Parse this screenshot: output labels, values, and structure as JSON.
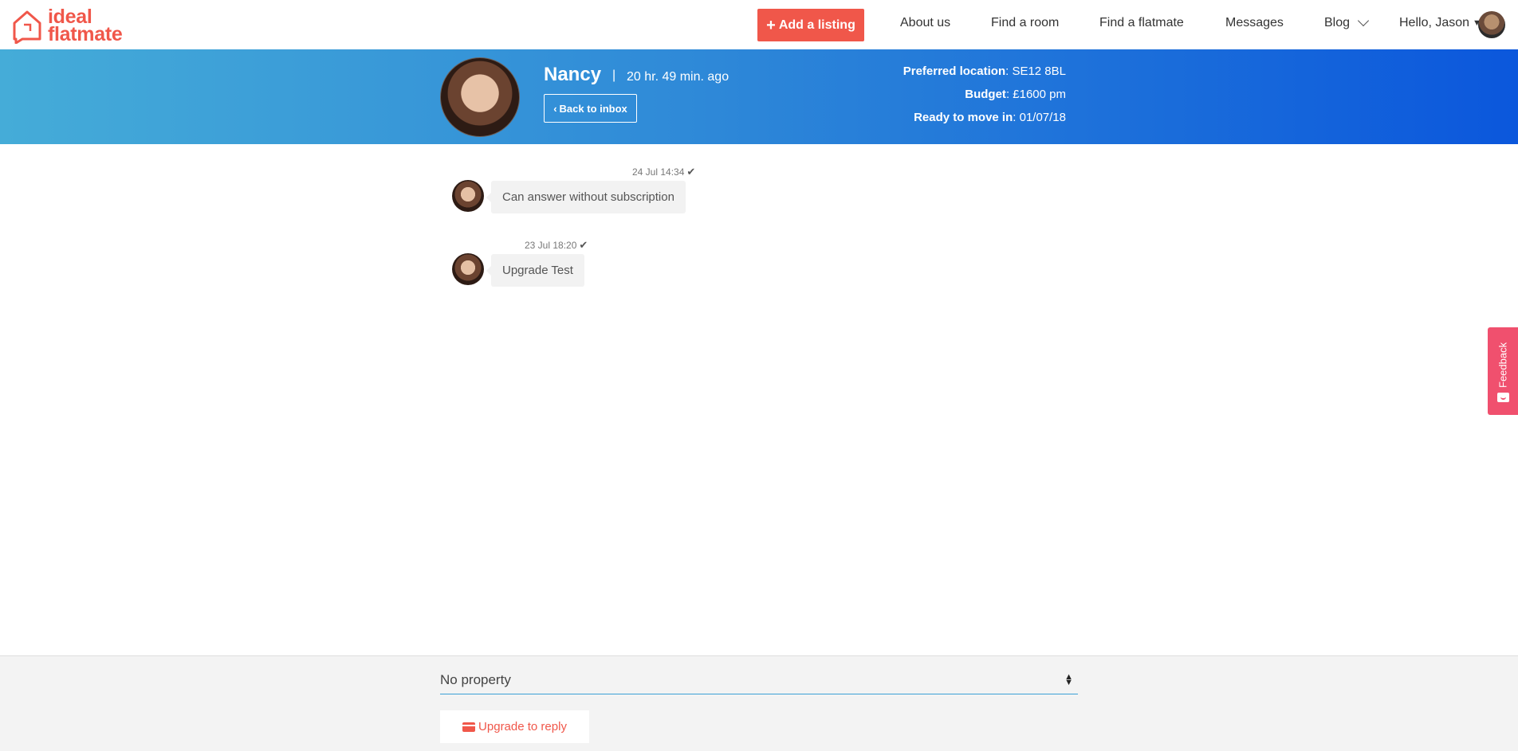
{
  "brand": {
    "line1": "ideal",
    "line2": "flatmate",
    "color": "#f0574a"
  },
  "nav": {
    "add_listing": "Add a listing",
    "about": "About us",
    "find_room": "Find a room",
    "find_flatmate": "Find a flatmate",
    "messages": "Messages",
    "blog": "Blog",
    "greeting": "Hello, Jason"
  },
  "contact": {
    "name": "Nancy",
    "separator": "|",
    "last_seen": "20 hr. 49 min. ago",
    "back_label": "Back to inbox",
    "preferred_location_label": "Preferred location",
    "preferred_location_value": ": SE12 8BL",
    "budget_label": "Budget",
    "budget_value": ": £1600 pm",
    "move_in_label": "Ready to move in",
    "move_in_value": ": 01/07/18"
  },
  "messages": [
    {
      "time": "24 Jul 14:34",
      "text": "Can answer without subscription"
    },
    {
      "time": "23 Jul 18:20",
      "text": "Upgrade Test"
    }
  ],
  "feedback": {
    "label": "Feedback"
  },
  "composer": {
    "property_value": "No property",
    "upgrade_label": "Upgrade to reply"
  },
  "colors": {
    "accent": "#f0574a",
    "band_start": "#45acd8",
    "band_end": "#0b57dc",
    "feedback": "#f0506e"
  }
}
